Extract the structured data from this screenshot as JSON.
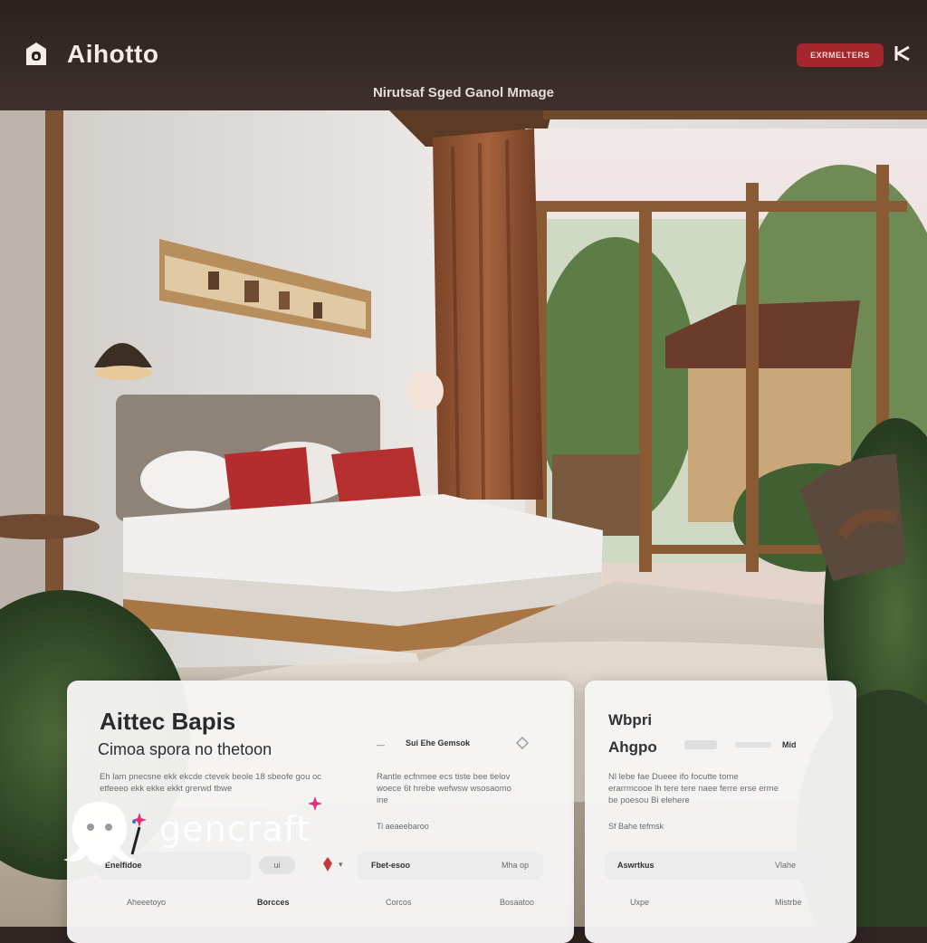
{
  "app": {
    "title": "Aihotto",
    "subtitle": "Nirutsaf Sged Ganol Mmage",
    "badge_label": "EXRMELTERS"
  },
  "card_left": {
    "title": "Aittec Bapis",
    "subtitle": "Cimoa spora no thetoon",
    "meta_label": "Sui Ehe Gemsok",
    "paragraph_left": "Eh lam pnecsne ekk ekcde ctevek beole 18 sbeofe gou oc etfeeeo ekk ekke ekkt grerwd tbwe",
    "paragraph_right": "Rantle ecfnmee ecs tiste bee tielov woece 6t hrebe wefwsw wsosaomo ine",
    "small_note": "Ti aeaeebaroo",
    "row_left_label": "Enelfidoe",
    "row_left_value": "ui",
    "row_mid_label": "Fbet-esoo",
    "row_mid_value": "Mha op",
    "footer_items": [
      "Aheeetoyo",
      "Borcces",
      "Corcos",
      "Bosaatoo"
    ]
  },
  "card_right": {
    "title": "Wbpri",
    "subtitle": "Ahgpo",
    "chip_label": "Mid",
    "paragraph": "Nl lebe fae Dueee ifo focutte tome erarrmcooe lh tere tere naee ferre erse erme be poesou Bi elehere",
    "small_note": "Sf Bahe tefmsk",
    "row_label": "Aswrtkus",
    "row_value": "Vlahe",
    "footer_items": [
      "Uxpe",
      "Mistrbe"
    ]
  },
  "watermark": {
    "text": "gencraft"
  },
  "colors": {
    "header_bg": "#2f2523",
    "accent_red": "#a3262c",
    "card_bg": "#f6f5f5"
  }
}
